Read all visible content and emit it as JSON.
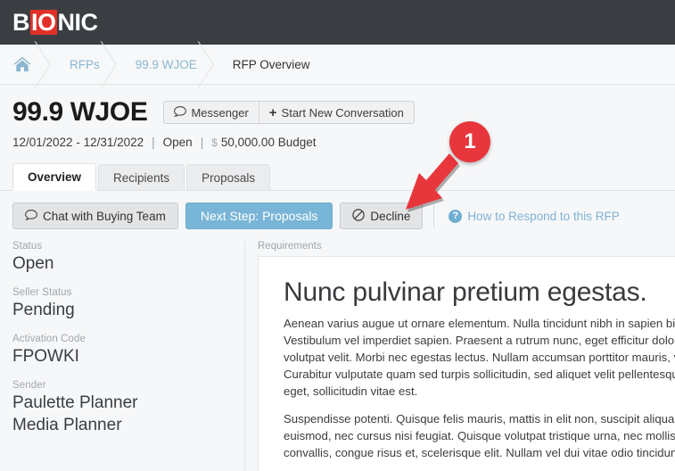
{
  "brand": {
    "logo_parts": [
      "B",
      "IO",
      "NIC"
    ],
    "logo_highlight_color": "#e03028",
    "topbar_color": "#3a3e43"
  },
  "breadcrumb": {
    "home_icon": "home-icon",
    "items": [
      {
        "label": "RFPs",
        "current": false
      },
      {
        "label": "99.9 WJOE",
        "current": false
      },
      {
        "label": "RFP Overview",
        "current": true
      }
    ]
  },
  "header": {
    "title": "99.9 WJOE",
    "messenger_icon": "speech-bubble-icon",
    "messenger_label": "Messenger",
    "new_conversation_icon": "plus-icon",
    "new_conversation_label": "Start New Conversation",
    "date_range": "12/01/2022 - 12/31/2022",
    "status": "Open",
    "currency_symbol": "$",
    "budget": "50,000.00 Budget",
    "separator": "|"
  },
  "tabs": [
    {
      "label": "Overview",
      "active": true
    },
    {
      "label": "Recipients",
      "active": false
    },
    {
      "label": "Proposals",
      "active": false
    }
  ],
  "actions": {
    "chat_icon": "speech-bubble-icon",
    "chat_label": "Chat with Buying Team",
    "next_step_label": "Next Step: Proposals",
    "next_step_color": "#79b5d6",
    "decline_icon": "no-entry-icon",
    "decline_label": "Decline",
    "help_icon": "question-mark-icon",
    "help_label": "How to Respond to this RFP",
    "help_color": "#7fb2d4"
  },
  "sidebar": {
    "fields": [
      {
        "label": "Status",
        "value": "Open"
      },
      {
        "label": "Seller Status",
        "value": "Pending"
      },
      {
        "label": "Activation Code",
        "value": "FPOWKI"
      },
      {
        "label": "Sender",
        "value": "Paulette Planner",
        "value2": "Media Planner"
      }
    ]
  },
  "requirements": {
    "label": "Requirements",
    "heading": "Nunc pulvinar pretium egestas.",
    "paragraph1_lines": [
      "Aenean varius augue ut ornare elementum. Nulla tincidunt nibh in sapien bibe",
      "Vestibulum vel imperdiet sapien. Praesent a rutrum nunc, eget efficitur dolor.",
      "volutpat velit. Morbi nec egestas lectus. Nullam accumsan porttitor mauris, v",
      "Curabitur vulputate quam sed turpis sollicitudin, sed aliquet velit pellentesque",
      "eget, sollicitudin vitae est."
    ],
    "paragraph2_lines": [
      "Suspendisse potenti. Quisque felis mauris, mattis in elit non, suscipit aliqua",
      "euismod, nec cursus nisi feugiat. Quisque volutpat tristique urna, nec mollis",
      "convallis, congue risus et, scelerisque elit. Nullam vel dui vitae odio tincidunt"
    ]
  },
  "annotation": {
    "badge_number": "1",
    "badge_color": "#e8373c",
    "arrow_target": "decline-button"
  }
}
